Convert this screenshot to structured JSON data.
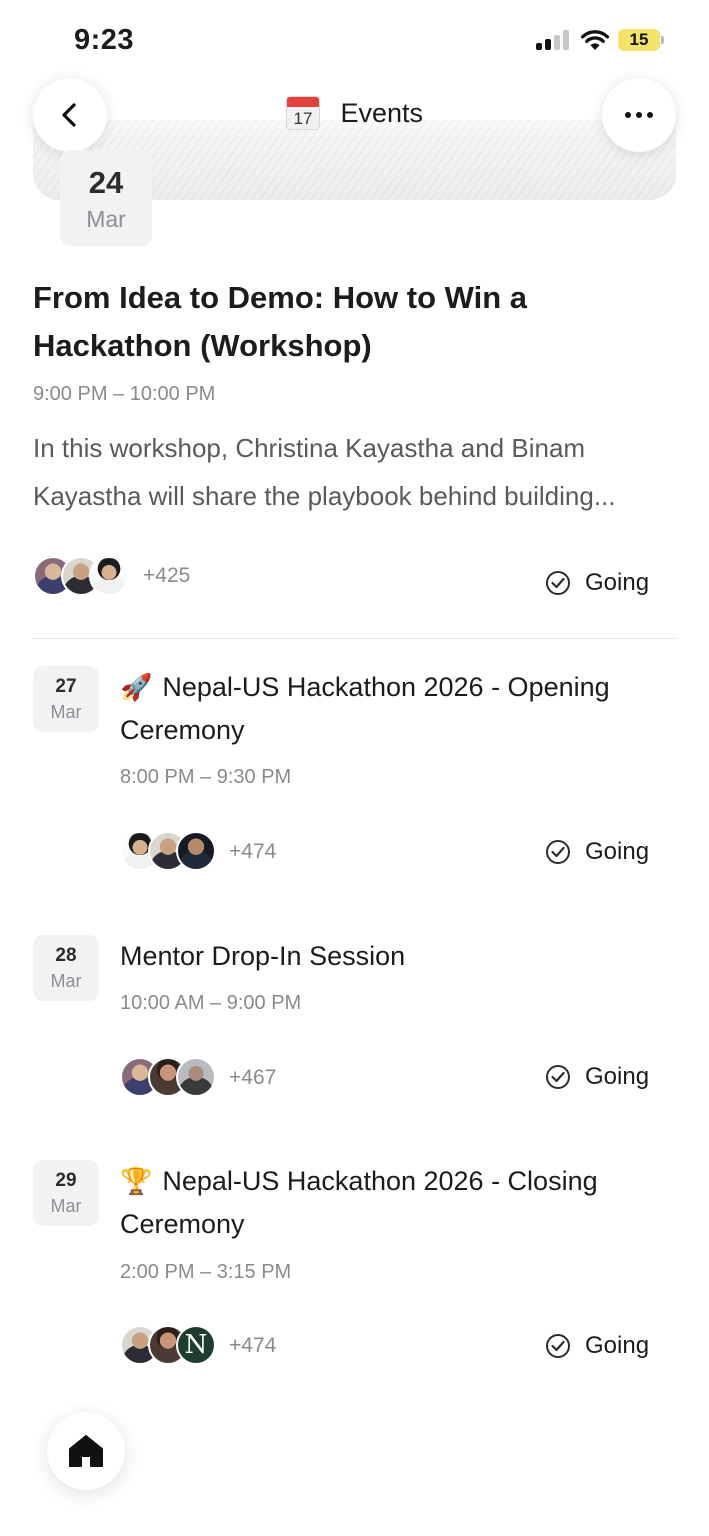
{
  "status_bar": {
    "time": "9:23",
    "battery": "15"
  },
  "header": {
    "title": "Events",
    "calendar_icon_day": "17",
    "back_icon": "chevron-left-icon",
    "more_icon": "ellipsis-icon"
  },
  "featured_event": {
    "date_day": "24",
    "date_month": "Mar",
    "title": "From Idea to Demo: How to Win a Hackathon (Workshop)",
    "time": "9:00 PM – 10:00 PM",
    "description": "In this workshop, Christina Kayastha and Binam Kayastha will share the playbook behind building...",
    "attendee_count": "+425",
    "rsvp_label": "Going"
  },
  "events": [
    {
      "date_day": "27",
      "date_month": "Mar",
      "emoji": "🚀",
      "title": "Nepal-US Hackathon 2026 - Opening Ceremony",
      "time": "8:00 PM – 9:30 PM",
      "attendee_count": "+474",
      "rsvp_label": "Going"
    },
    {
      "date_day": "28",
      "date_month": "Mar",
      "emoji": "",
      "title": "Mentor Drop-In Session",
      "time": "10:00 AM – 9:00 PM",
      "attendee_count": "+467",
      "rsvp_label": "Going"
    },
    {
      "date_day": "29",
      "date_month": "Mar",
      "emoji": "🏆",
      "title": "Nepal-US Hackathon 2026 - Closing Ceremony",
      "time": "2:00 PM – 3:15 PM",
      "attendee_count": "+474",
      "rsvp_label": "Going",
      "avatar_letter": "N"
    }
  ],
  "bottom_nav": {
    "home_icon": "home-icon"
  }
}
